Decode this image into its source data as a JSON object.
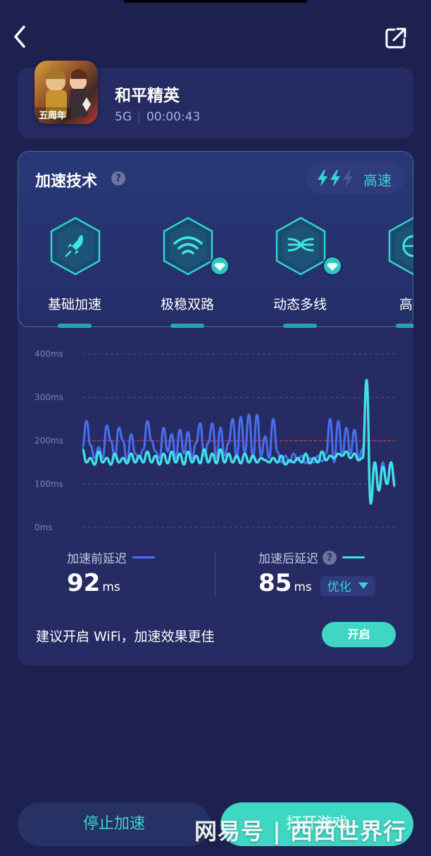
{
  "header": {
    "back_icon": "chevron-left-icon",
    "share_icon": "external-share-icon"
  },
  "game": {
    "name": "和平精英",
    "network": "5G",
    "duration": "00:00:43",
    "icon_badge": "五周年"
  },
  "tech": {
    "title": "加速技术",
    "help": "?",
    "speed_label": "高速",
    "items": [
      {
        "label": "基础加速",
        "icon": "rocket-icon",
        "premium": false
      },
      {
        "label": "极稳双路",
        "icon": "dual-wifi-icon",
        "premium": true
      },
      {
        "label": "动态多线",
        "icon": "multiline-icon",
        "premium": true
      },
      {
        "label": "高速",
        "icon": "globe-icon",
        "premium": false
      }
    ]
  },
  "chart_data": {
    "type": "line",
    "yticks": [
      "0ms",
      "100ms",
      "200ms",
      "300ms",
      "400ms"
    ],
    "ylim": [
      0,
      400
    ],
    "reference_line": 200,
    "series": [
      {
        "name": "加速前延迟",
        "color": "#4a6ef0",
        "values": [
          185,
          245,
          190,
          160,
          185,
          160,
          235,
          200,
          160,
          230,
          200,
          150,
          215,
          170,
          160,
          180,
          245,
          200,
          175,
          160,
          230,
          175,
          215,
          160,
          225,
          170,
          220,
          160,
          195,
          240,
          165,
          195,
          240,
          160,
          230,
          165,
          195,
          250,
          160,
          255,
          170,
          260,
          160,
          260,
          165,
          210,
          160,
          250,
          175,
          150,
          165,
          150,
          170,
          155,
          165,
          148,
          160,
          150,
          165,
          152,
          170,
          250,
          150,
          245,
          165,
          230,
          170,
          225,
          160,
          180,
          330,
          60,
          140,
          90,
          150,
          100,
          145,
          105
        ]
      },
      {
        "name": "加速后延迟",
        "color": "#3fe0e6",
        "values": [
          180,
          150,
          160,
          145,
          175,
          150,
          160,
          145,
          170,
          150,
          160,
          148,
          170,
          150,
          165,
          150,
          175,
          150,
          165,
          145,
          170,
          148,
          175,
          150,
          170,
          145,
          175,
          150,
          165,
          148,
          180,
          150,
          170,
          148,
          180,
          150,
          170,
          150,
          165,
          148,
          170,
          150,
          165,
          150,
          160,
          155,
          150,
          160,
          150,
          165,
          145,
          155,
          150,
          160,
          150,
          170,
          148,
          160,
          150,
          175,
          155,
          165,
          160,
          170,
          165,
          175,
          160,
          170,
          155,
          160,
          340,
          55,
          150,
          85,
          140,
          100,
          150,
          95
        ]
      }
    ]
  },
  "latency": {
    "before_label": "加速前延迟",
    "before_value": "92",
    "before_unit": "ms",
    "before_color": "#4a6ef0",
    "after_label": "加速后延迟",
    "after_value": "85",
    "after_unit": "ms",
    "after_color": "#3fe0e6",
    "optimize_label": "优化"
  },
  "wifi": {
    "tip": "建议开启 WiFi，加速效果更佳",
    "button": "开启"
  },
  "footer": {
    "stop_label": "停止加速",
    "open_label": "打开游戏",
    "watermark": "网易号 | 西西世界行"
  }
}
